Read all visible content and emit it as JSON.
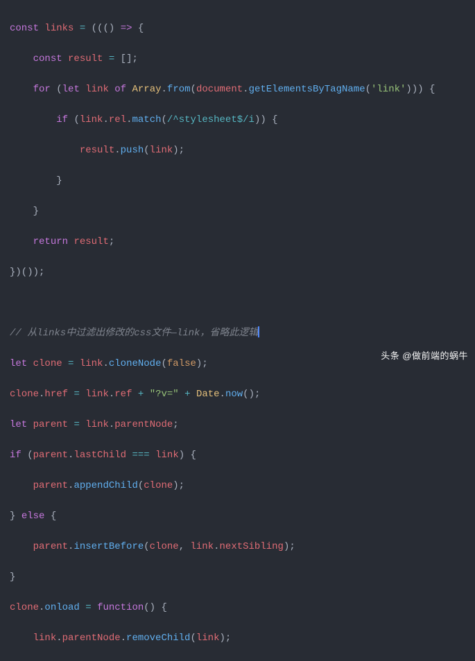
{
  "code": {
    "l1": {
      "kw1": "const",
      "v1": "links",
      "op1": "=",
      "p1": "(((",
      "p2": ") ",
      "op2": "=>",
      "p3": " {"
    },
    "l2": {
      "kw1": "const",
      "v1": "result",
      "op1": "=",
      "p1": "[];"
    },
    "l3": {
      "kw1": "for",
      "p1": "(",
      "kw2": "let",
      "v1": "link",
      "kw3": "of",
      "obj1": "Array",
      "p2": ".",
      "fn1": "from",
      "p3": "(",
      "v2": "document",
      "p4": ".",
      "fn2": "getElementsByTagName",
      "p5": "(",
      "str1": "'link'",
      "p6": "))) {"
    },
    "l4": {
      "kw1": "if",
      "p1": "(",
      "v1": "link",
      "p2": ".",
      "v2": "rel",
      "p3": ".",
      "fn1": "match",
      "p4": "(",
      "regex1": "/^stylesheet$/i",
      "p5": ")) {"
    },
    "l5": {
      "v1": "result",
      "p1": ".",
      "fn1": "push",
      "p2": "(",
      "v2": "link",
      "p3": ");"
    },
    "l6": {
      "p1": "}"
    },
    "l7": {
      "p1": "}"
    },
    "l8": {
      "kw1": "return",
      "v1": "result",
      "p1": ";"
    },
    "l9": {
      "p1": "})());"
    },
    "l10": {
      "comment": "// 从links中过滤出修改的css文件—link，省略此逻辑"
    },
    "l11": {
      "kw1": "let",
      "v1": "clone",
      "op1": "=",
      "v2": "link",
      "p1": ".",
      "fn1": "cloneNode",
      "p2": "(",
      "num1": "false",
      "p3": ");"
    },
    "l12": {
      "v1": "clone",
      "p1": ".",
      "v2": "href",
      "op1": "=",
      "v3": "link",
      "p2": ".",
      "v4": "ref",
      "op2": "+",
      "str1": "\"?v=\"",
      "op3": "+",
      "obj1": "Date",
      "p3": ".",
      "fn1": "now",
      "p4": "();"
    },
    "l13": {
      "kw1": "let",
      "v1": "parent",
      "op1": "=",
      "v2": "link",
      "p1": ".",
      "v3": "parentNode",
      "p2": ";"
    },
    "l14": {
      "kw1": "if",
      "p1": "(",
      "v1": "parent",
      "p2": ".",
      "v2": "lastChild",
      "op1": "===",
      "v3": "link",
      "p3": ") {"
    },
    "l15": {
      "v1": "parent",
      "p1": ".",
      "fn1": "appendChild",
      "p2": "(",
      "v2": "clone",
      "p3": ");"
    },
    "l16": {
      "p1": "} ",
      "kw1": "else",
      "p2": " {"
    },
    "l17": {
      "v1": "parent",
      "p1": ".",
      "fn1": "insertBefore",
      "p2": "(",
      "v2": "clone",
      "p3": ", ",
      "v3": "link",
      "p4": ".",
      "v4": "nextSibling",
      "p5": ");"
    },
    "l18": {
      "p1": "}"
    },
    "l19": {
      "v1": "clone",
      "p1": ".",
      "fn1": "onload",
      "op1": "=",
      "kw1": "function",
      "p2": "() {"
    },
    "l20": {
      "v1": "link",
      "p1": ".",
      "v2": "parentNode",
      "p2": ".",
      "fn1": "removeChild",
      "p3": "(",
      "v3": "link",
      "p4": ");"
    }
  },
  "watermark": "头条 @做前端的蜗牛"
}
